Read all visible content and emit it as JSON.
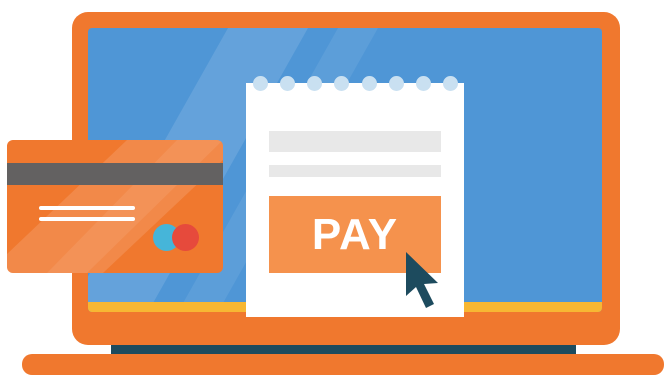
{
  "illustration": {
    "subject": "online-payment",
    "laptop": {
      "frame_color": "#f0782e",
      "screen_color": "#4f96d6",
      "accent_strip_color": "#f7b733",
      "base_shadow_color": "#1d4b5e"
    },
    "receipt": {
      "paper_color": "#ffffff",
      "hole_color": "#c9e0f1",
      "line_color": "#e8e8e8",
      "pay_button": {
        "label": "PAY",
        "color": "#f5924d",
        "text_color": "#ffffff"
      },
      "cursor": {
        "icon": "mouse-pointer-icon",
        "color": "#1d4b5e"
      }
    },
    "credit_card": {
      "color": "#f0782e",
      "stripe_color": "#636161",
      "logo": {
        "icon": "card-network-logo",
        "left_circle_color": "#46b5d9",
        "right_circle_color": "#e64a3c"
      }
    }
  }
}
